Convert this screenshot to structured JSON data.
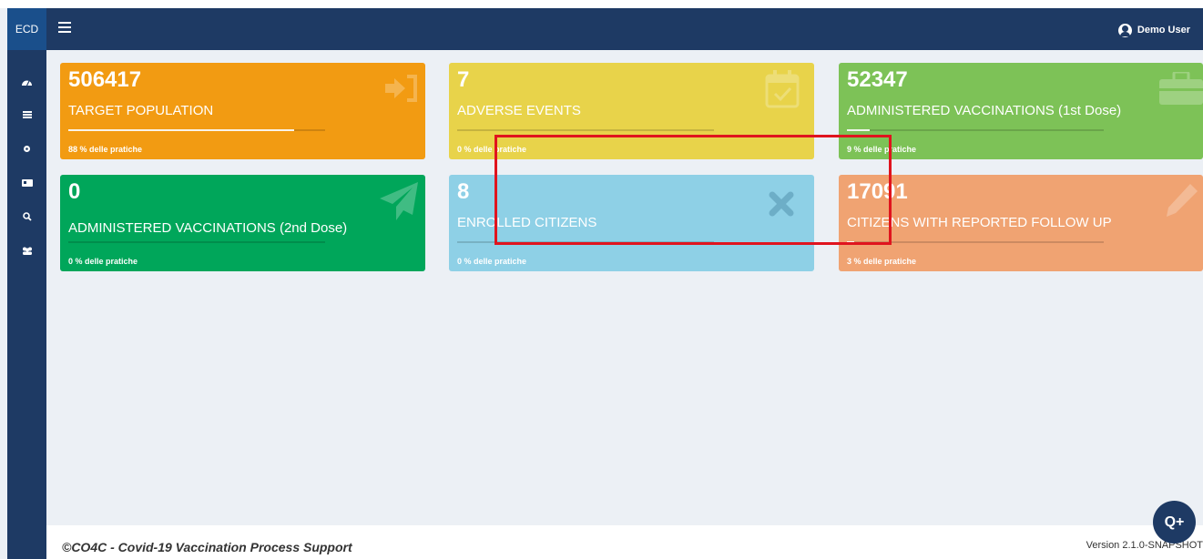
{
  "header": {
    "brand": "ECD",
    "user": "Demo User"
  },
  "sidebar": {
    "icons": [
      "dashboard-icon",
      "list-icon",
      "gear-icon",
      "id-card-icon",
      "search-icon",
      "users-icon"
    ]
  },
  "cards": [
    {
      "value": "506417",
      "title": "TARGET POPULATION",
      "percent_text": "88 % delle pratiche",
      "progress": 0.88,
      "color": "#f29b12",
      "icon": "sign-in-icon"
    },
    {
      "value": "7",
      "title": "ADVERSE EVENTS",
      "percent_text": "0 % delle pratiche",
      "progress": 0,
      "color": "#e8d34a",
      "icon": "calendar-check-icon"
    },
    {
      "value": "52347",
      "title": "ADMINISTERED VACCINATIONS (1st Dose)",
      "percent_text": "9 % delle pratiche",
      "progress": 0.09,
      "color": "#7dc257",
      "icon": "briefcase-icon"
    },
    {
      "value": "0",
      "title": "ADMINISTERED VACCINATIONS (2nd Dose)",
      "percent_text": "0 % delle pratiche",
      "progress": 0,
      "color": "#00a65a",
      "icon": "paper-plane-icon"
    },
    {
      "value": "8",
      "title": "ENROLLED CITIZENS",
      "percent_text": "0 % delle pratiche",
      "progress": 0,
      "color": "#8ed0e6",
      "icon": "close-icon"
    },
    {
      "value": "17091",
      "title": "CITIZENS WITH REPORTED FOLLOW UP",
      "percent_text": "3 % delle pratiche",
      "progress": 0.03,
      "color": "#f0a372",
      "icon": "pencil-icon"
    }
  ],
  "footer": {
    "copyright": "©CO4C - Covid-19 Vaccination Process Support",
    "version": "Version 2.1.0-SNAPSHOT"
  },
  "fab": {
    "label": "Q+"
  },
  "colors": {
    "navbar": "#1e3a64",
    "highlight": "#e0141e"
  }
}
